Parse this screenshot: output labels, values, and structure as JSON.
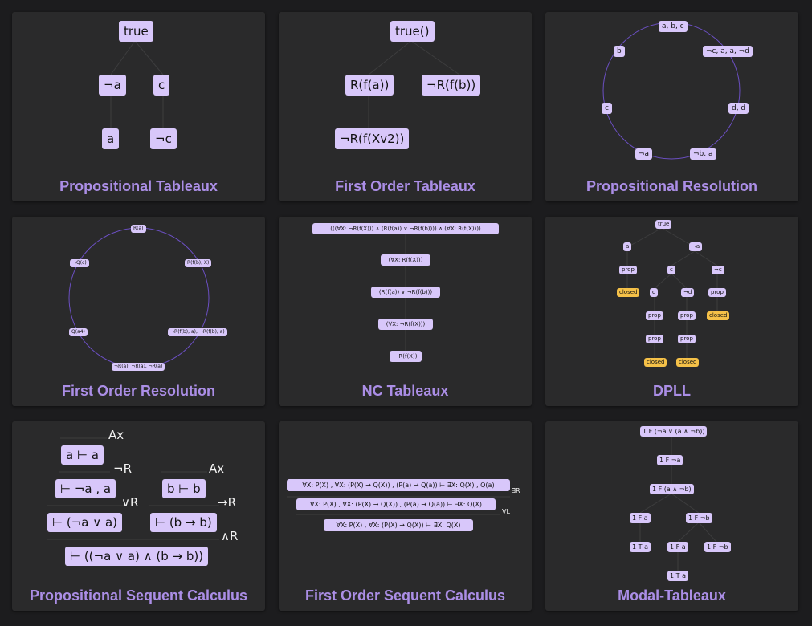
{
  "cards": [
    {
      "title": "Propositional Tableaux",
      "nodes": [
        "true",
        "¬a",
        "c",
        "a",
        "¬c"
      ]
    },
    {
      "title": "First Order Tableaux",
      "nodes": [
        "true()",
        "R(f(a))",
        "¬R(f(b))",
        "¬R(f(Xv2))"
      ]
    },
    {
      "title": "Propositional Resolution",
      "nodes": [
        "a, b, c",
        "¬c, a, a, ¬d",
        "d, d",
        "¬b, a",
        "¬a",
        "c",
        "b"
      ]
    },
    {
      "title": "First Order Resolution",
      "nodes": [
        "R(a)",
        "R(f(b), X)",
        "¬R(f(b), a), ¬R(f(b), a)",
        "¬R(a), ¬R(a), ¬R(a)",
        "Q(a4)",
        "¬Q(c)"
      ]
    },
    {
      "title": "NC Tableaux",
      "nodes": [
        "(((∀X: ¬R(f(X))) ∧ (R(f(a)) ∨ ¬R(f(b)))) ∧ (∀X: R(f(X))))",
        "(∀X: R(f(X)))",
        "(R(f(a)) ∨ ¬R(f(b)))",
        "(∀X: ¬R(f(X)))",
        "¬R(f(X))"
      ]
    },
    {
      "title": "DPLL",
      "nodes": [
        "true",
        "a",
        "¬a",
        "prop",
        "c",
        "¬c",
        "closed",
        "d",
        "¬d",
        "prop",
        "prop",
        "prop",
        "closed",
        "prop",
        "prop",
        "closed",
        "closed"
      ]
    },
    {
      "title": "Propositional Sequent Calculus",
      "nodes": [
        "a ⊢ a",
        "⊢ ¬a , a",
        "b ⊢ b",
        "⊢ (¬a ∨ a)",
        "⊢ (b → b)",
        "⊢ ((¬a ∨ a) ∧ (b → b))"
      ],
      "rules": [
        "Ax",
        "¬R",
        "Ax",
        "∨R",
        "→R",
        "∧R"
      ]
    },
    {
      "title": "First Order Sequent Calculus",
      "nodes": [
        "∀X: P(X) ,  ∀X: (P(X) → Q(X)) ,  (P(a) → Q(a)) ⊢ ∃X: Q(X) , Q(a)",
        "∀X: P(X) ,  ∀X: (P(X) → Q(X)) ,  (P(a) → Q(a)) ⊢ ∃X: Q(X)",
        "∀X: P(X) ,  ∀X: (P(X) → Q(X)) ⊢ ∃X: Q(X)"
      ],
      "rules": [
        "∃R",
        "∀L"
      ]
    },
    {
      "title": "Modal-Tableaux",
      "nodes": [
        "1 F (¬a ∨ (a ∧ ¬b))",
        "1 F ¬a",
        "1 F (a ∧ ¬b)",
        "1 F a",
        "1 F ¬b",
        "1 T a",
        "1 F a",
        "1 F ¬b",
        "1 T a"
      ]
    }
  ],
  "colors": {
    "background": "#1c1c1e",
    "card": "#2a2a2b",
    "title": "#ab8ee6",
    "node": "#d8c7fa",
    "closed": "#f5c148",
    "circle": "#6b4fc2"
  }
}
